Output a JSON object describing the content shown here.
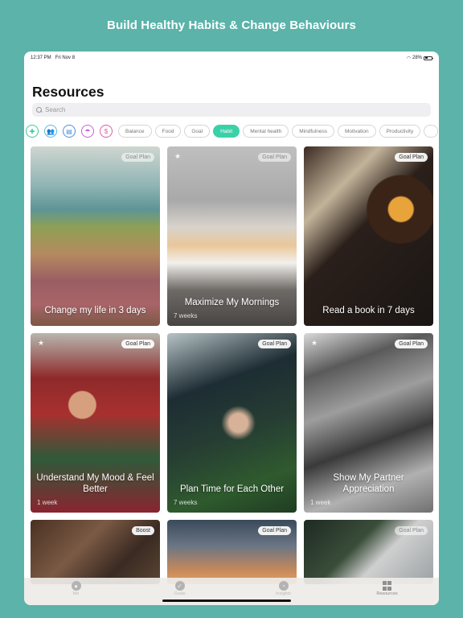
{
  "headline": "Build Healthy Habits & Change Behaviours",
  "status_bar": {
    "time": "12:37 PM",
    "date": "Fri Nov 8",
    "battery": "28%"
  },
  "page_title": "Resources",
  "search": {
    "placeholder": "Search",
    "value": ""
  },
  "icon_filters": [
    {
      "icon": "puzzle-icon",
      "glyph": "✚",
      "color": "#3bc99a"
    },
    {
      "icon": "people-icon",
      "glyph": "👥",
      "color": "#5ab9e0"
    },
    {
      "icon": "chat-icon",
      "glyph": "▤",
      "color": "#4b8fe0"
    },
    {
      "icon": "umbrella-icon",
      "glyph": "☂",
      "color": "#c065d6"
    },
    {
      "icon": "dollar-icon",
      "glyph": "$",
      "color": "#e15aa8"
    }
  ],
  "categories": [
    {
      "label": "Balance",
      "active": false
    },
    {
      "label": "Food",
      "active": false
    },
    {
      "label": "Goal",
      "active": false
    },
    {
      "label": "Habit",
      "active": true
    },
    {
      "label": "Mental health",
      "active": false
    },
    {
      "label": "Mindfulness",
      "active": false
    },
    {
      "label": "Motivation",
      "active": false
    },
    {
      "label": "Productivity",
      "active": false
    }
  ],
  "cards": [
    {
      "title": "Change my life in 3 days",
      "subtitle": "",
      "badge": "Goal Plan",
      "starred": false
    },
    {
      "title": "Maximize My Mornings",
      "subtitle": "7 weeks",
      "badge": "Goal Plan",
      "starred": true
    },
    {
      "title": "Read a book in 7 days",
      "subtitle": "",
      "badge": "Goal Plan",
      "starred": false
    },
    {
      "title": "Understand My Mood & Feel Better",
      "subtitle": "1 week",
      "badge": "Goal Plan",
      "starred": true
    },
    {
      "title": "Plan Time for Each Other",
      "subtitle": "7 weeks",
      "badge": "Goal Plan",
      "starred": false
    },
    {
      "title": "Show My Partner Appreciation",
      "subtitle": "1 week",
      "badge": "Goal Plan",
      "starred": true
    },
    {
      "title": "",
      "subtitle": "",
      "badge": "Boost",
      "starred": false
    },
    {
      "title": "",
      "subtitle": "",
      "badge": "Goal Plan",
      "starred": false
    },
    {
      "title": "",
      "subtitle": "",
      "badge": "Goal Plan",
      "starred": false
    }
  ],
  "tabbar": [
    {
      "label": "Me",
      "icon": "person-icon",
      "active": false
    },
    {
      "label": "Goals",
      "icon": "checkmark-icon",
      "active": false
    },
    {
      "label": "Insights",
      "icon": "pie-chart-icon",
      "active": false
    },
    {
      "label": "Resources",
      "icon": "grid-icon",
      "active": true
    }
  ],
  "colors": {
    "background": "#5bb3aa",
    "accent": "#3bd1a8"
  }
}
